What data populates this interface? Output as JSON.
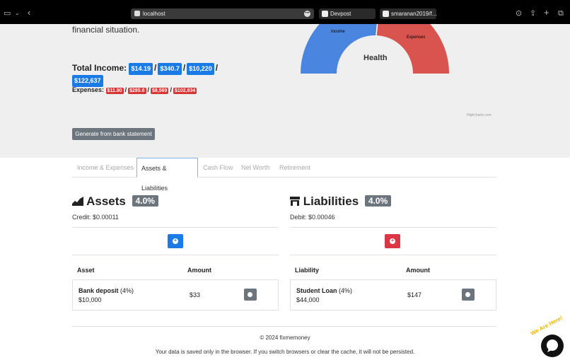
{
  "browser": {
    "url": "localhost",
    "tabs": [
      {
        "label": "Devpost"
      },
      {
        "label": "smaranan2019/f..."
      }
    ]
  },
  "summary": {
    "intro": "financial situation.",
    "total_income_label": "Total Income:",
    "income_values": [
      "$14.19",
      "$340.7",
      "$10,220",
      "$122,637"
    ],
    "expenses_label": "Expenses:",
    "expense_values": [
      "$11.90",
      "$285.6",
      "$8,569",
      "$102,834"
    ],
    "generate_button": "Generate from bank statement",
    "chart_credits": "Highcharts.com"
  },
  "gauge": {
    "title": "Health",
    "income_label": "Income",
    "expenses_label": "Expenses",
    "income_color": "#4a86e0",
    "expenses_color": "#d9534f"
  },
  "tabs": [
    {
      "label": "Income & Expenses",
      "active": false
    },
    {
      "label": "Assets & Liabilities",
      "active": true
    },
    {
      "label": "Cash Flow",
      "active": false
    },
    {
      "label": "Net Worth",
      "active": false
    },
    {
      "label": "Retirement",
      "active": false
    }
  ],
  "assets": {
    "title": "Assets",
    "percent": "4.0%",
    "credit": "Credit: $0.00011",
    "col_name": "Asset",
    "col_amount": "Amount",
    "items": [
      {
        "name": "Bank deposit",
        "pct": "(4%)",
        "value": "$10,000",
        "amount": "$33"
      }
    ],
    "add_color": "#1a7be6"
  },
  "liabilities": {
    "title": "Liabilities",
    "percent": "4.0%",
    "debit": "Debit: $0.00046",
    "col_name": "Liability",
    "col_amount": "Amount",
    "items": [
      {
        "name": "Student Loan",
        "pct": "(4%)",
        "value": "$44,000",
        "amount": "$147"
      }
    ],
    "add_color": "#dc3545"
  },
  "footer": {
    "copyright": "© 2024 fixmemoney",
    "note": "Your data is saved only in the browser. If you switch browsers or clear the cache, it will not be persisted."
  },
  "chat": {
    "tag": "We Are Here!"
  }
}
